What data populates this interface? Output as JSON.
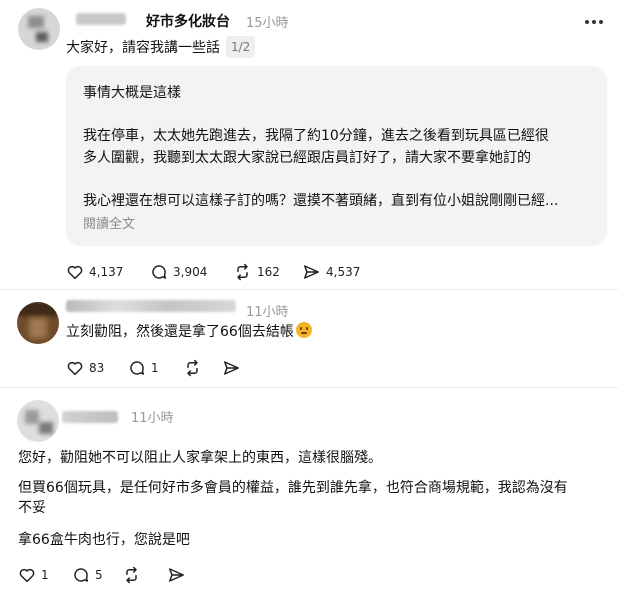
{
  "post": {
    "username": "好市多化妝台",
    "time": "15小時",
    "text": "大家好，請容我講一些話",
    "page_badge": "1/2",
    "quote": {
      "title": "事情大概是這樣",
      "para1_line1": "我在停車，太太她先跑進去，我隔了約10分鐘，進去之後看到玩具區已經很",
      "para1_line2": "多人圍觀，我聽到太太跟大家說已經跟店員訂好了，請大家不要拿她訂的",
      "para2_line1": "我心裡還在想可以這樣子訂的嗎？還摸不著頭緒，直到有位小姐說剛剛已經...",
      "read_more": "閱讀全文"
    },
    "stats": {
      "likes": "4,137",
      "comments": "3,904",
      "reposts": "162",
      "shares": "4,537"
    }
  },
  "reply1": {
    "time": "11小時",
    "text": "立刻勸阻，然後還是拿了66個去結帳",
    "stats": {
      "likes": "83",
      "comments": "1"
    }
  },
  "reply2": {
    "time": "11小時",
    "line1": "您好，勸阻她不可以阻止人家拿架上的東西，這樣很腦殘。",
    "line2": "但買66個玩具，是任何好市多會員的權益，誰先到誰先拿，也符合商場規範，我認為沒有",
    "line3": "不妥",
    "line4": "拿66盒牛肉也行，您說是吧",
    "stats": {
      "likes": "1",
      "comments": "5"
    }
  },
  "icons": [
    "more-icon",
    "heart-icon",
    "comment-icon",
    "repost-icon",
    "share-icon",
    "thinking-emoji-icon"
  ]
}
